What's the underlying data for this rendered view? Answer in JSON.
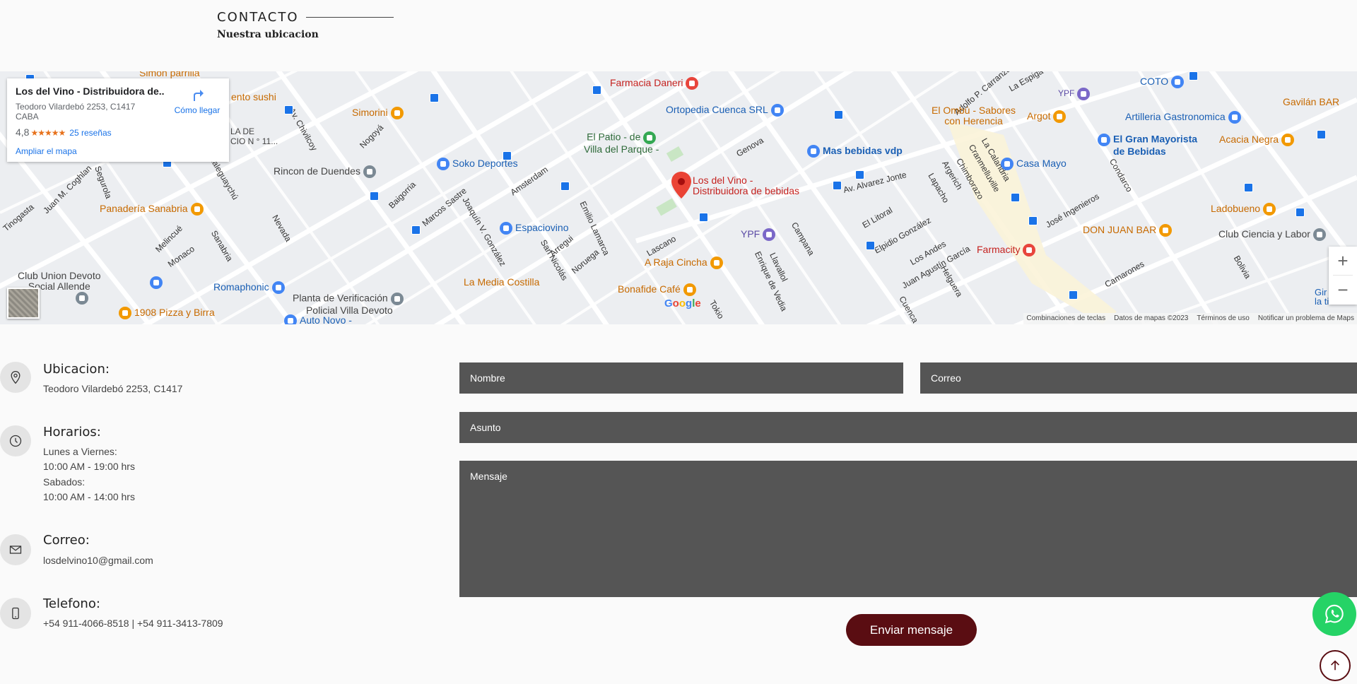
{
  "header": {
    "title": "CONTACTO",
    "subtitle": "Nuestra ubicacion"
  },
  "map": {
    "card": {
      "name": "Los del Vino - Distribuidora de...",
      "address": "Teodoro Vilardebó 2253, C1417 CABA",
      "rating": "4,8",
      "stars": "★★★★★",
      "reviews": "25 reseñas",
      "directions": "Cómo llegar",
      "enlarge": "Ampliar el mapa"
    },
    "pin_label": "Los del Vino -\nDistribuidora de bebidas",
    "pin_label_line1": "Los del Vino -",
    "pin_label_line2": "Distribuidora de bebidas",
    "pois": {
      "farmacia_daneri": "Farmacia Daneri",
      "ortopedia": "Ortopedia Cuenca SRL",
      "el_patio": "El Patio - de",
      "el_patio2": "Villa del Parque -",
      "simorini": "Simorini",
      "soko": "Soko Deportes",
      "rincon": "Rincon de Duendes",
      "panaderia": "Panadería Sanabria",
      "espaciovino": "Espaciovino",
      "club_union": "Club Union Devoto",
      "club_union2": "Social Allende",
      "romaphonic": "Romaphonic",
      "planta": "Planta de Verificación",
      "planta2": "Policial Villa Devoto",
      "la_media": "La Media Costilla",
      "pizza": "1908 Pizza y Birra",
      "a_raja": "A Raja Cincha",
      "bonafide": "Bonafide Café",
      "mas_bebidas": "Mas bebidas vdp",
      "el_ombu": "El Ombú - Sabores",
      "el_ombu2": "con Herencia",
      "argot": "Argot",
      "coto": "COTO",
      "artilleria": "Artilleria Gastronomica",
      "gran_mayorista": "El Gran Mayorista",
      "gran_mayorista2": "de Bebidas",
      "casa_mayo": "Casa Mayo",
      "gavilan": "Gavilán BAR",
      "acacia": "Acacia Negra",
      "ladobueno": "Ladobueno",
      "don_juan": "DON JUAN BAR",
      "farmacity": "Farmacity",
      "club_ciencia": "Club Ciencia y Labor",
      "ypf1": "YPF",
      "ypf2": "YPF",
      "sushi": "ento sushi",
      "simon": "Simon parrilla",
      "auto_novo": "Auto Novo -",
      "partial1": "LA DE",
      "partial2": "CIO N ° 11...",
      "partial3": "Gir",
      "partial4": "la tierra"
    },
    "streets": [
      "Lascano",
      "Av. Alvarez Jonte",
      "Sanabria",
      "Nogoyá",
      "Baigorria",
      "Amsterdam",
      "Marcos Sastre",
      "Joaquín V. González",
      "Emilio Lamarca",
      "Genova",
      "Campana",
      "Llavallol",
      "Enrique de Vedia",
      "Juan Agustín García",
      "José Ingenieros",
      "Condarco",
      "El Litoral",
      "Elpidio González",
      "Los Andes",
      "Helguera",
      "Cuenca",
      "Av. Chivilcoy",
      "Nevada",
      "Melincué",
      "Monaco",
      "Segurola",
      "Juan M. Coghlan",
      "Tinogasta",
      "Gualeguaychú",
      "Arregui",
      "Noruega",
      "San Nicolás",
      "Tokio",
      "Lapacho",
      "Chimborazo",
      "Cranmelluville",
      "La Calandria",
      "Argerich",
      "Bolivia",
      "Camarones",
      "Adolfo P. Carranza",
      "La Espiga"
    ],
    "zoom_in": "+",
    "zoom_out": "−",
    "footer": [
      "Combinaciones de teclas",
      "Datos de mapas ©2023",
      "Términos de uso",
      "Notificar un problema de Maps"
    ],
    "google": "Google"
  },
  "info": {
    "location_title": "Ubicacion:",
    "location_text": "Teodoro Vilardebó 2253, C1417",
    "hours_title": "Horarios:",
    "hours_line1": "Lunes a Viernes:",
    "hours_line2": "10:00 AM - 19:00 hrs",
    "hours_line3": "Sabados:",
    "hours_line4": "10:00 AM - 14:00 hrs",
    "email_title": "Correo:",
    "email_text": "losdelvino10@gmail.com",
    "phone_title": "Telefono:",
    "phone_text": "+54 911-4066-8518 | +54 911-3413-7809"
  },
  "form": {
    "name_placeholder": "Nombre",
    "email_placeholder": "Correo",
    "subject_placeholder": "Asunto",
    "message_placeholder": "Mensaje",
    "submit_label": "Enviar mensaje"
  },
  "colors": {
    "field_bg": "#555555",
    "button_bg": "#5a0d12",
    "whatsapp": "#25d366"
  },
  "icons": [
    "location-pin-icon",
    "clock-icon",
    "envelope-icon",
    "phone-icon",
    "whatsapp-icon",
    "arrow-up-icon",
    "directions-icon",
    "map-pin-icon"
  ]
}
